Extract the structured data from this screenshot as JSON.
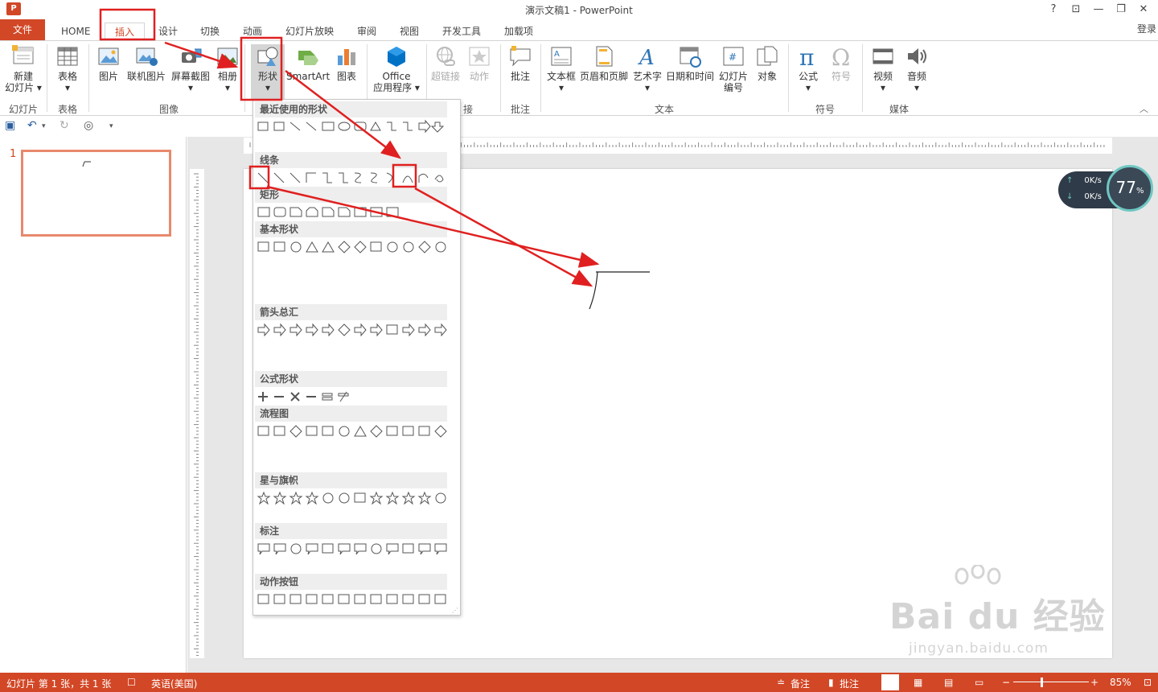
{
  "title": "演示文稿1 - PowerPoint",
  "window_controls": [
    "?",
    "⊡",
    "—",
    "❐",
    "✕"
  ],
  "tabs": [
    {
      "label": "文件",
      "active": false
    },
    {
      "label": "HOME",
      "active": false
    },
    {
      "label": "插入",
      "active": true
    },
    {
      "label": "设计",
      "active": false
    },
    {
      "label": "切换",
      "active": false
    },
    {
      "label": "动画",
      "active": false
    },
    {
      "label": "幻灯片放映",
      "active": false
    },
    {
      "label": "审阅",
      "active": false
    },
    {
      "label": "视图",
      "active": false
    },
    {
      "label": "开发工具",
      "active": false
    },
    {
      "label": "加载项",
      "active": false
    }
  ],
  "login": "登录",
  "ribbon": {
    "buttons": [
      {
        "label": "新建",
        "label2": "幻灯片 ▾"
      },
      {
        "label": "表格",
        "label2": "▾"
      },
      {
        "label": "图片",
        "label2": ""
      },
      {
        "label": "联机图片",
        "label2": ""
      },
      {
        "label": "屏幕截图",
        "label2": "▾"
      },
      {
        "label": "相册",
        "label2": "▾"
      },
      {
        "label": "形状",
        "label2": "▾"
      },
      {
        "label": "SmartArt",
        "label2": ""
      },
      {
        "label": "图表",
        "label2": ""
      },
      {
        "label": "Office",
        "label2": "应用程序 ▾"
      },
      {
        "label": "超链接",
        "label2": ""
      },
      {
        "label": "动作",
        "label2": ""
      },
      {
        "label": "批注",
        "label2": ""
      },
      {
        "label": "文本框",
        "label2": "▾"
      },
      {
        "label": "页眉和页脚",
        "label2": ""
      },
      {
        "label": "艺术字",
        "label2": "▾"
      },
      {
        "label": "日期和时间",
        "label2": ""
      },
      {
        "label": "幻灯片",
        "label2": "编号"
      },
      {
        "label": "对象",
        "label2": ""
      },
      {
        "label": "公式",
        "label2": "▾"
      },
      {
        "label": "符号",
        "label2": ""
      },
      {
        "label": "视频",
        "label2": "▾"
      },
      {
        "label": "音频",
        "label2": "▾"
      }
    ],
    "groups": [
      "幻灯片",
      "表格",
      "图像",
      "接",
      "批注",
      "文本",
      "符号",
      "媒体"
    ]
  },
  "shapes_menu": {
    "sections": [
      "最近使用的形状",
      "线条",
      "矩形",
      "基本形状",
      "箭头总汇",
      "公式形状",
      "流程图",
      "星与旗帜",
      "标注",
      "动作按钮"
    ]
  },
  "slide_panel": {
    "number": "1"
  },
  "speed_widget": {
    "up": "0K/s",
    "down": "0K/s",
    "percent": "77",
    "unit": "%"
  },
  "status": {
    "slide_info": "幻灯片 第 1 张，共 1 张",
    "language": "英语(美国)",
    "notes": "备注",
    "comments": "批注",
    "zoom": "85%"
  },
  "watermark": {
    "brand": "Bai du 经验",
    "url": "jingyan.baidu.com"
  },
  "colors": {
    "accent": "#d24726",
    "highlight": "#e02020",
    "status_bg": "#d24726"
  }
}
